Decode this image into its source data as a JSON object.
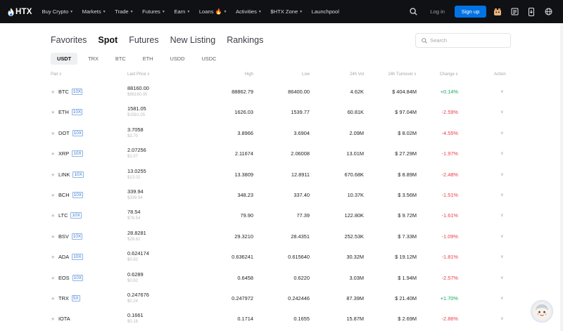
{
  "brand": {
    "name": "HTX"
  },
  "nav": [
    {
      "label": "Buy Crypto",
      "dropdown": true
    },
    {
      "label": "Markets",
      "dropdown": true
    },
    {
      "label": "Trade",
      "dropdown": true
    },
    {
      "label": "Futures",
      "dropdown": true
    },
    {
      "label": "Earn",
      "dropdown": true
    },
    {
      "label": "Loans",
      "dropdown": true,
      "fire": true
    },
    {
      "label": "Activities",
      "dropdown": true
    },
    {
      "label": "$HTX Zone",
      "dropdown": true
    },
    {
      "label": "Launchpool",
      "dropdown": false
    }
  ],
  "auth": {
    "login": "Log in",
    "signup": "Sign up"
  },
  "main_tabs": [
    "Favorites",
    "Spot",
    "Futures",
    "New Listing",
    "Rankings"
  ],
  "active_main_tab": "Spot",
  "search": {
    "placeholder": "Search",
    "value": ""
  },
  "quote_tabs": [
    "USDT",
    "TRX",
    "BTC",
    "ETH",
    "USDD",
    "USDC"
  ],
  "active_quote_tab": "USDT",
  "columns": {
    "pair": "Pair",
    "last_price": "Last Price",
    "high": "High",
    "low": "Low",
    "vol": "24h Vol",
    "turnover": "24h Turnover",
    "change": "Change",
    "action": "Action"
  },
  "rows": [
    {
      "pair": "BTC",
      "lev": "10X",
      "price": "88160.00",
      "price_sub": "$88160.00",
      "high": "88862.79",
      "low": "86400.00",
      "vol": "4.62K",
      "turnover": "$ 404.84M",
      "change": "+0.14%",
      "dir": "up"
    },
    {
      "pair": "ETH",
      "lev": "10X",
      "price": "1581.05",
      "price_sub": "$1581.05",
      "high": "1626.03",
      "low": "1539.77",
      "vol": "60.81K",
      "turnover": "$ 97.04M",
      "change": "-2.59%",
      "dir": "down"
    },
    {
      "pair": "DOT",
      "lev": "10X",
      "price": "3.7058",
      "price_sub": "$3.70",
      "high": "3.8966",
      "low": "3.6904",
      "vol": "2.09M",
      "turnover": "$ 8.02M",
      "change": "-4.55%",
      "dir": "down"
    },
    {
      "pair": "XRP",
      "lev": "10X",
      "price": "2.07256",
      "price_sub": "$2.07",
      "high": "2.11674",
      "low": "2.06008",
      "vol": "13.01M",
      "turnover": "$ 27.29M",
      "change": "-1.97%",
      "dir": "down"
    },
    {
      "pair": "LINK",
      "lev": "10X",
      "price": "13.0255",
      "price_sub": "$13.02",
      "high": "13.3809",
      "low": "12.8911",
      "vol": "670.68K",
      "turnover": "$ 8.89M",
      "change": "-2.48%",
      "dir": "down"
    },
    {
      "pair": "BCH",
      "lev": "10X",
      "price": "339.94",
      "price_sub": "$339.94",
      "high": "348.23",
      "low": "337.40",
      "vol": "10.37K",
      "turnover": "$ 3.56M",
      "change": "-1.51%",
      "dir": "down"
    },
    {
      "pair": "LTC",
      "lev": "10X",
      "price": "78.54",
      "price_sub": "$78.54",
      "high": "79.90",
      "low": "77.39",
      "vol": "122.80K",
      "turnover": "$ 9.72M",
      "change": "-1.61%",
      "dir": "down"
    },
    {
      "pair": "BSV",
      "lev": "10X",
      "price": "28.8281",
      "price_sub": "$28.82",
      "high": "29.3210",
      "low": "28.4351",
      "vol": "252.53K",
      "turnover": "$ 7.33M",
      "change": "-1.09%",
      "dir": "down"
    },
    {
      "pair": "ADA",
      "lev": "10X",
      "price": "0.624174",
      "price_sub": "$0.62",
      "high": "0.636241",
      "low": "0.615640",
      "vol": "30.32M",
      "turnover": "$ 19.12M",
      "change": "-1.81%",
      "dir": "down"
    },
    {
      "pair": "EOS",
      "lev": "10X",
      "price": "0.6289",
      "price_sub": "$0.62",
      "high": "0.6458",
      "low": "0.6220",
      "vol": "3.03M",
      "turnover": "$ 1.94M",
      "change": "-2.57%",
      "dir": "down"
    },
    {
      "pair": "TRX",
      "lev": "5X",
      "price": "0.247676",
      "price_sub": "$0.24",
      "high": "0.247972",
      "low": "0.242446",
      "vol": "87.39M",
      "turnover": "$ 21.40M",
      "change": "+1.70%",
      "dir": "up"
    },
    {
      "pair": "IOTA",
      "lev": "",
      "price": "0.1661",
      "price_sub": "$0.16",
      "high": "0.1714",
      "low": "0.1655",
      "vol": "15.87M",
      "turnover": "$ 2.69M",
      "change": "-2.86%",
      "dir": "down"
    }
  ],
  "colors": {
    "accent": "#0173e5",
    "up": "#1aa75e",
    "down": "#e8404b",
    "nav_bg": "#101114"
  },
  "icons": [
    "htx-flame-logo-icon",
    "search-icon",
    "gift-icon",
    "download-app-icon",
    "notice-icon",
    "language-globe-icon",
    "star-icon",
    "chevron-down-icon",
    "assistant-avatar-icon"
  ]
}
